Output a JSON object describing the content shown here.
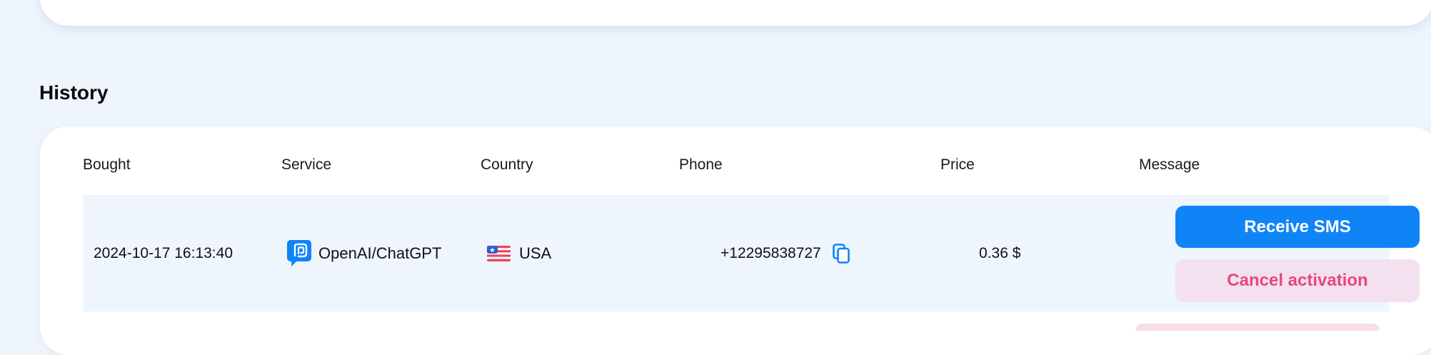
{
  "history": {
    "title": "History",
    "columns": [
      "Bought",
      "Service",
      "Country",
      "Phone",
      "Price",
      "Message"
    ],
    "rows": [
      {
        "bought": "2024-10-17 16:13:40",
        "service": "OpenAI/ChatGPT",
        "service_icon": "openai-chatgpt-icon",
        "country": "USA",
        "country_icon": "usa-flag-icon",
        "phone": "+12295838727",
        "price": "0.36 $",
        "receive_label": "Receive SMS",
        "cancel_label": "Cancel activation"
      }
    ]
  },
  "colors": {
    "background": "#eef5fd",
    "primary": "#0f84f7",
    "cancel_text": "#e8477d",
    "cancel_bg": "#f3e1ef",
    "row_bg": "#eef5fd"
  }
}
